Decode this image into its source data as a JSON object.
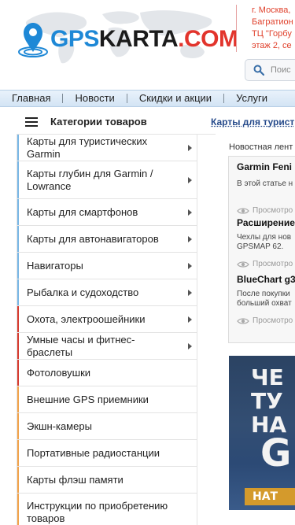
{
  "header": {
    "logo": {
      "part1": "GPS",
      "part2": "KARTA",
      "part3": ".COM"
    },
    "address_lines": [
      "г. Москва,",
      "Багратион",
      "ТЦ \"Горбу",
      "этаж 2, се"
    ],
    "search_placeholder": "Поис"
  },
  "nav": {
    "items": [
      {
        "label": "Главная"
      },
      {
        "label": "Новости"
      },
      {
        "label": "Скидки и акции"
      },
      {
        "label": "Услуги"
      }
    ]
  },
  "categories": {
    "title": "Категории товаров",
    "items": [
      {
        "label": "Карты для туристических Garmin",
        "arrow": true,
        "accent": "#79b7e6",
        "height": 34
      },
      {
        "label": "Карты глубин для Garmin / Lowrance",
        "arrow": true,
        "accent": "#79b7e6",
        "height": 48
      },
      {
        "label": "Карты для смартфонов",
        "arrow": true,
        "accent": "#79b7e6",
        "height": 34
      },
      {
        "label": "Карты для автонавигаторов",
        "arrow": true,
        "accent": "#79b7e6",
        "height": 34
      },
      {
        "label": "Навигаторы",
        "arrow": true,
        "accent": "#79b7e6",
        "height": 34
      },
      {
        "label": "Рыбалка и судоходство",
        "arrow": true,
        "accent": "#79b7e6",
        "height": 34
      },
      {
        "label": "Охота, электроошейники",
        "arrow": true,
        "accent": "#d63a2e",
        "height": 34
      },
      {
        "label": "Умные часы и фитнес-браслеты",
        "arrow": true,
        "accent": "#d63a2e",
        "height": 34
      },
      {
        "label": "Фотоловушки",
        "arrow": false,
        "accent": "#d63a2e",
        "height": 34
      },
      {
        "label": "Внешние GPS приемники",
        "arrow": false,
        "accent": "#f2a24a",
        "height": 34
      },
      {
        "label": "Экшн-камеры",
        "arrow": false,
        "accent": "#f2a24a",
        "height": 34
      },
      {
        "label": "Портативные радиостанции",
        "arrow": false,
        "accent": "#f2a24a",
        "height": 34
      },
      {
        "label": "Карты флэш памяти",
        "arrow": false,
        "accent": "#f2a24a",
        "height": 34
      },
      {
        "label": "Инструкции по приобретению товаров",
        "arrow": false,
        "accent": "#f2a24a",
        "height": 48
      }
    ]
  },
  "breadcrumb": "Карты для турист",
  "news": {
    "label": "Новостная лент",
    "items": [
      {
        "title": "Garmin Feni",
        "text": [
          "В этой статье н"
        ],
        "views": "Просмотро"
      },
      {
        "title": "Расширение",
        "text": [
          "Чехлы для нов",
          "GPSMAP 62."
        ],
        "views": "Просмотро"
      },
      {
        "title": "BlueChart g3",
        "text": [
          "После покупки",
          "больший охват"
        ],
        "views": "Просмотро"
      }
    ]
  },
  "banner": {
    "lines": [
      "ЧЕ",
      "ТУ",
      "НА"
    ],
    "big": "G",
    "footer": "НАТ"
  },
  "colors": {
    "accent_blue": "#79b7e6",
    "accent_red": "#d63a2e",
    "accent_orange": "#f2a24a",
    "link": "#24498a",
    "address": "#e0412c"
  }
}
